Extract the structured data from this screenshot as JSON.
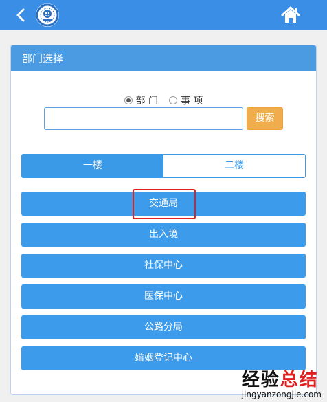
{
  "header": {
    "back_icon": "chevron-left-icon",
    "logo_icon": "agency-logo-icon",
    "home_icon": "home-icon",
    "bar_color": "#3a8ee6"
  },
  "panel": {
    "title": "部门选择"
  },
  "search": {
    "radio_options": [
      {
        "label": "部 门",
        "checked": true
      },
      {
        "label": "事 项",
        "checked": false
      }
    ],
    "input_value": "",
    "button_label": "搜索",
    "button_color": "#f0ad4e"
  },
  "floor_tabs": [
    {
      "label": "一楼",
      "active": true
    },
    {
      "label": "二楼",
      "active": false
    }
  ],
  "departments": [
    {
      "label": "交通局",
      "highlighted": true
    },
    {
      "label": "出入境",
      "highlighted": false
    },
    {
      "label": "社保中心",
      "highlighted": false
    },
    {
      "label": "医保中心",
      "highlighted": false
    },
    {
      "label": "公路分局",
      "highlighted": false
    },
    {
      "label": "婚姻登记中心",
      "highlighted": false
    }
  ],
  "watermark": {
    "text_black": "经验",
    "text_red": "总结",
    "url": "jingyanzongjie.com"
  },
  "colors": {
    "accent": "#3c9bea",
    "highlight_border": "#e02020"
  }
}
